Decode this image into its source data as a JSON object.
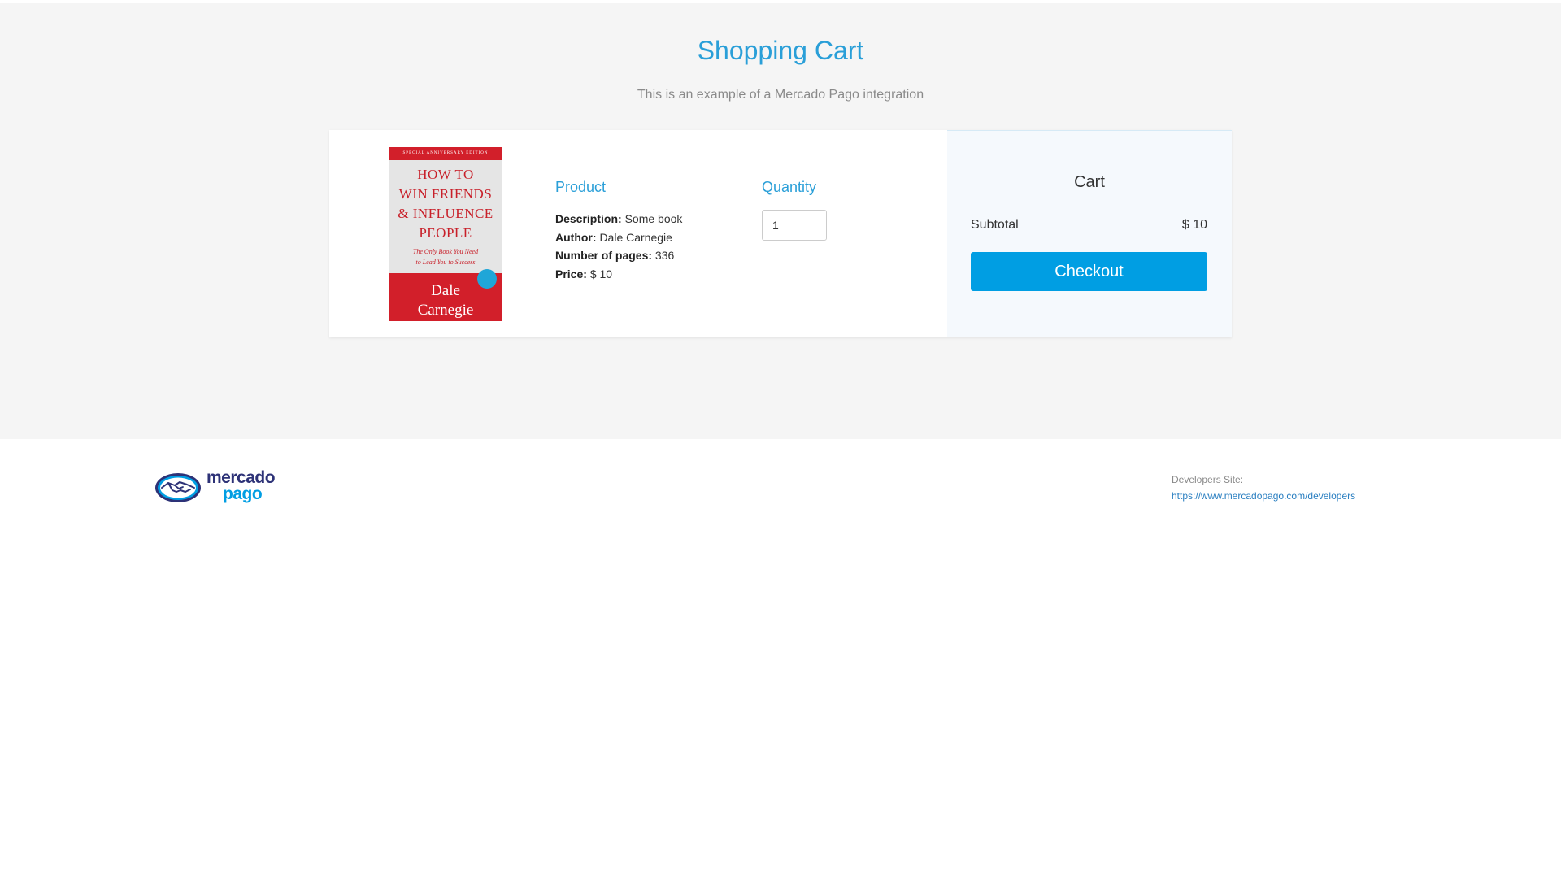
{
  "header": {
    "title": "Shopping Cart",
    "subtitle": "This is an example of a Mercado Pago integration"
  },
  "product": {
    "cover": {
      "edition": "SPECIAL ANNIVERSARY EDITION",
      "title_lines": [
        "HOW TO",
        "WIN FRIENDS",
        "& INFLUENCE",
        "PEOPLE"
      ],
      "tagline_lines": [
        "The Only Book You Need",
        "to Lead You to Success"
      ],
      "author_lines": [
        "Dale",
        "Carnegie"
      ]
    },
    "heading": "Product",
    "details": [
      {
        "label": "Description:",
        "value": "Some book"
      },
      {
        "label": "Author:",
        "value": "Dale Carnegie"
      },
      {
        "label": "Number of pages:",
        "value": "336"
      },
      {
        "label": "Price:",
        "value": "$ 10"
      }
    ]
  },
  "quantity": {
    "heading": "Quantity",
    "value": "1"
  },
  "cart": {
    "title": "Cart",
    "subtotal_label": "Subtotal",
    "subtotal_value": "$ 10",
    "checkout_label": "Checkout"
  },
  "footer": {
    "logo_word1": "mercado",
    "logo_word2": "pago",
    "dev_label": "Developers Site:",
    "dev_link": "https://www.mercadopago.com/developers"
  },
  "colors": {
    "accent": "#009ee3",
    "title_blue": "#2a9fd8",
    "brand_navy": "#2d3277",
    "book_red": "#d21f2a"
  },
  "icons": {
    "logo": "mercado-pago-handshake-icon"
  }
}
